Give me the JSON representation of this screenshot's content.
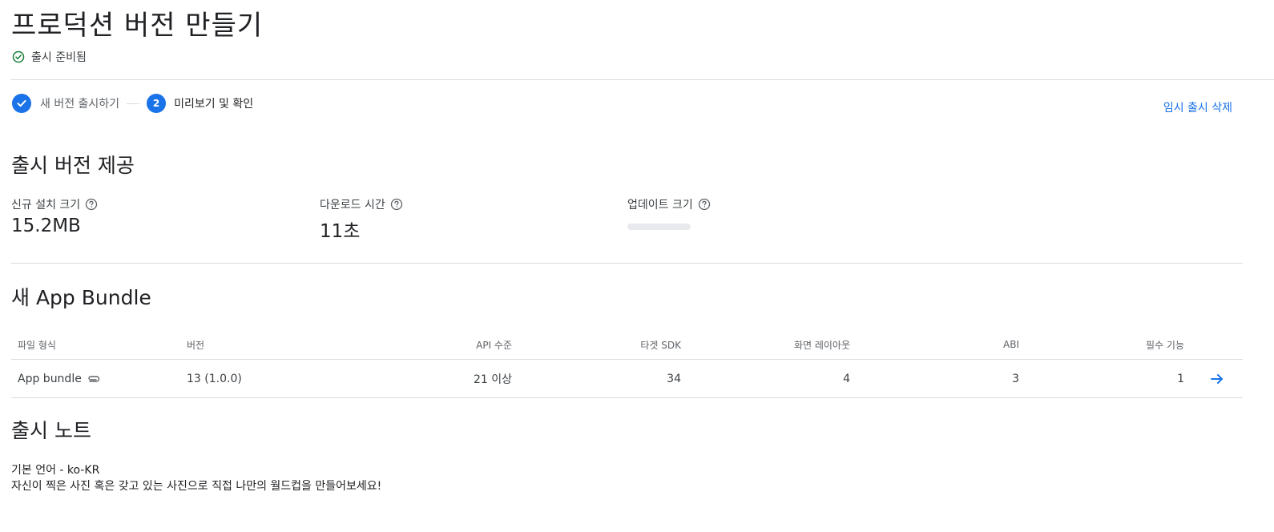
{
  "header": {
    "title": "프로덕션 버전 만들기",
    "status": "출시 준비됨"
  },
  "stepper": {
    "step1_label": "새 버전 출시하기",
    "step2_number": "2",
    "step2_label": "미리보기 및 확인"
  },
  "actions": {
    "delete_draft": "임시 출시 삭제"
  },
  "release_section": {
    "title": "출시 버전 제공",
    "new_install_size_label": "신규 설치 크기",
    "new_install_size_value": "15.2MB",
    "download_time_label": "다운로드 시간",
    "download_time_value": "11초",
    "update_size_label": "업데이트 크기"
  },
  "bundle_section": {
    "title": "새 App Bundle",
    "columns": [
      "파일 형식",
      "버전",
      "API 수준",
      "타겟 SDK",
      "화면 레이아웃",
      "ABI",
      "필수 기능"
    ],
    "row": {
      "file_type": "App bundle",
      "version": "13 (1.0.0)",
      "api_level": "21 이상",
      "target_sdk": "34",
      "screen_layouts": "4",
      "abi": "3",
      "required_features": "1"
    }
  },
  "notes_section": {
    "title": "출시 노트",
    "language": "기본 언어 - ko-KR",
    "text": "자신이 찍은 사진 혹은 갖고 있는 사진으로 직접 나만의 월드컵을 만들어보세요!"
  },
  "colors": {
    "accent": "#1a73e8",
    "success": "#188038",
    "divider": "#dadce0"
  }
}
